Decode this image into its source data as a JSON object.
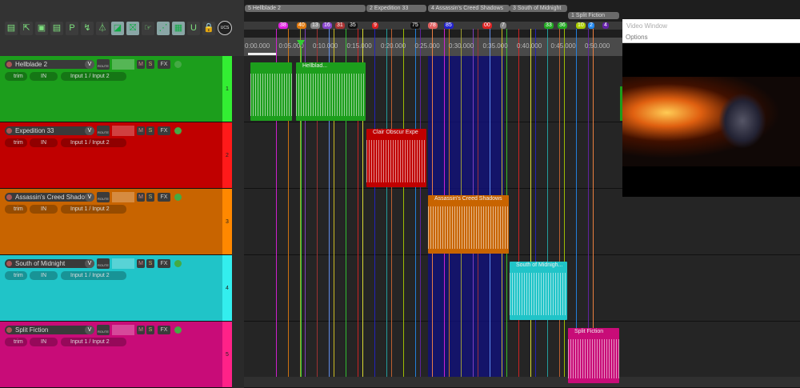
{
  "toolbar": {
    "icons": [
      "new-project",
      "open-project",
      "save-project",
      "project-settings",
      "ripple-edit",
      "envelope",
      "metronome",
      "auto-crossfade",
      "grid-snap",
      "item-select",
      "envelope-points",
      "grid",
      "loop",
      "lock",
      "ucs"
    ],
    "ucs_label": "UCS"
  },
  "regions": [
    {
      "label": "5  Hellblade 2"
    },
    {
      "label": "2  Expedition 33"
    },
    {
      "label": "4  Assassin's Creed Shadows"
    },
    {
      "label": "3  South of Midnight"
    },
    {
      "label": "1  Split Fiction"
    }
  ],
  "markers": [
    {
      "label": "38",
      "color": "#e020e0"
    },
    {
      "label": "40",
      "color": "#e07a10"
    },
    {
      "label": "13",
      "color": "#888888"
    },
    {
      "label": "16",
      "color": "#8844cc"
    },
    {
      "label": "31",
      "color": "#aa3333"
    },
    {
      "label": "35",
      "color": "#111111"
    },
    {
      "label": "9",
      "color": "#dd2222"
    },
    {
      "label": "75",
      "color": "#111111"
    },
    {
      "label": "78",
      "color": "#e06060"
    },
    {
      "label": "85",
      "color": "#2222cc"
    },
    {
      "label": "00",
      "color": "#dd2222"
    },
    {
      "label": "7",
      "color": "#888888"
    },
    {
      "label": "33",
      "color": "#22aa22"
    },
    {
      "label": "36",
      "color": "#22aa22"
    },
    {
      "label": "10",
      "color": "#aacc00"
    },
    {
      "label": "2",
      "color": "#2288ee"
    },
    {
      "label": "4",
      "color": "#6622aa"
    }
  ],
  "ruler": [
    "0:00.000",
    "0:05.000",
    "0:10.000",
    "0:15.000",
    "0:20.000",
    "0:25.000",
    "0:30.000",
    "0:35.000",
    "0:40.000",
    "0:45.000",
    "0:50.000"
  ],
  "tracks": [
    {
      "name": "Hellblade 2",
      "number": "1",
      "input": "Input 1 / Input 2",
      "trim": "trim",
      "in": "IN",
      "color": "#1c9e1c",
      "strip": "#33ee33",
      "item_label": "Hellblad..."
    },
    {
      "name": "Expedition 33",
      "number": "2",
      "input": "Input 1 / Input 2",
      "trim": "trim",
      "in": "IN",
      "color": "#c00000",
      "strip": "#ff1a1a",
      "item_label": "Clair Obscur Expe"
    },
    {
      "name": "Assassin's Creed Shadov",
      "number": "3",
      "input": "Input 1 / Input 2",
      "trim": "trim",
      "in": "IN",
      "color": "#c86400",
      "strip": "#ff8800",
      "item_label": "Assassin's Creed Shadows"
    },
    {
      "name": "South of Midnight",
      "number": "4",
      "input": "Input 1 / Input 2",
      "trim": "trim",
      "in": "IN",
      "color": "#20c4c8",
      "strip": "#33eeee",
      "item_label": "South of Midnigh..."
    },
    {
      "name": "Split Fiction",
      "number": "5",
      "input": "Input 1 / Input 2",
      "trim": "trim",
      "in": "IN",
      "color": "#c80c78",
      "strip": "#ff2288",
      "item_label": "Split Fiction"
    }
  ],
  "track_buttons": {
    "mute": "M",
    "solo": "S",
    "fx": "FX",
    "volume": "V",
    "route": "ROUTE"
  },
  "video": {
    "title": "Video Window",
    "options": "Options"
  }
}
